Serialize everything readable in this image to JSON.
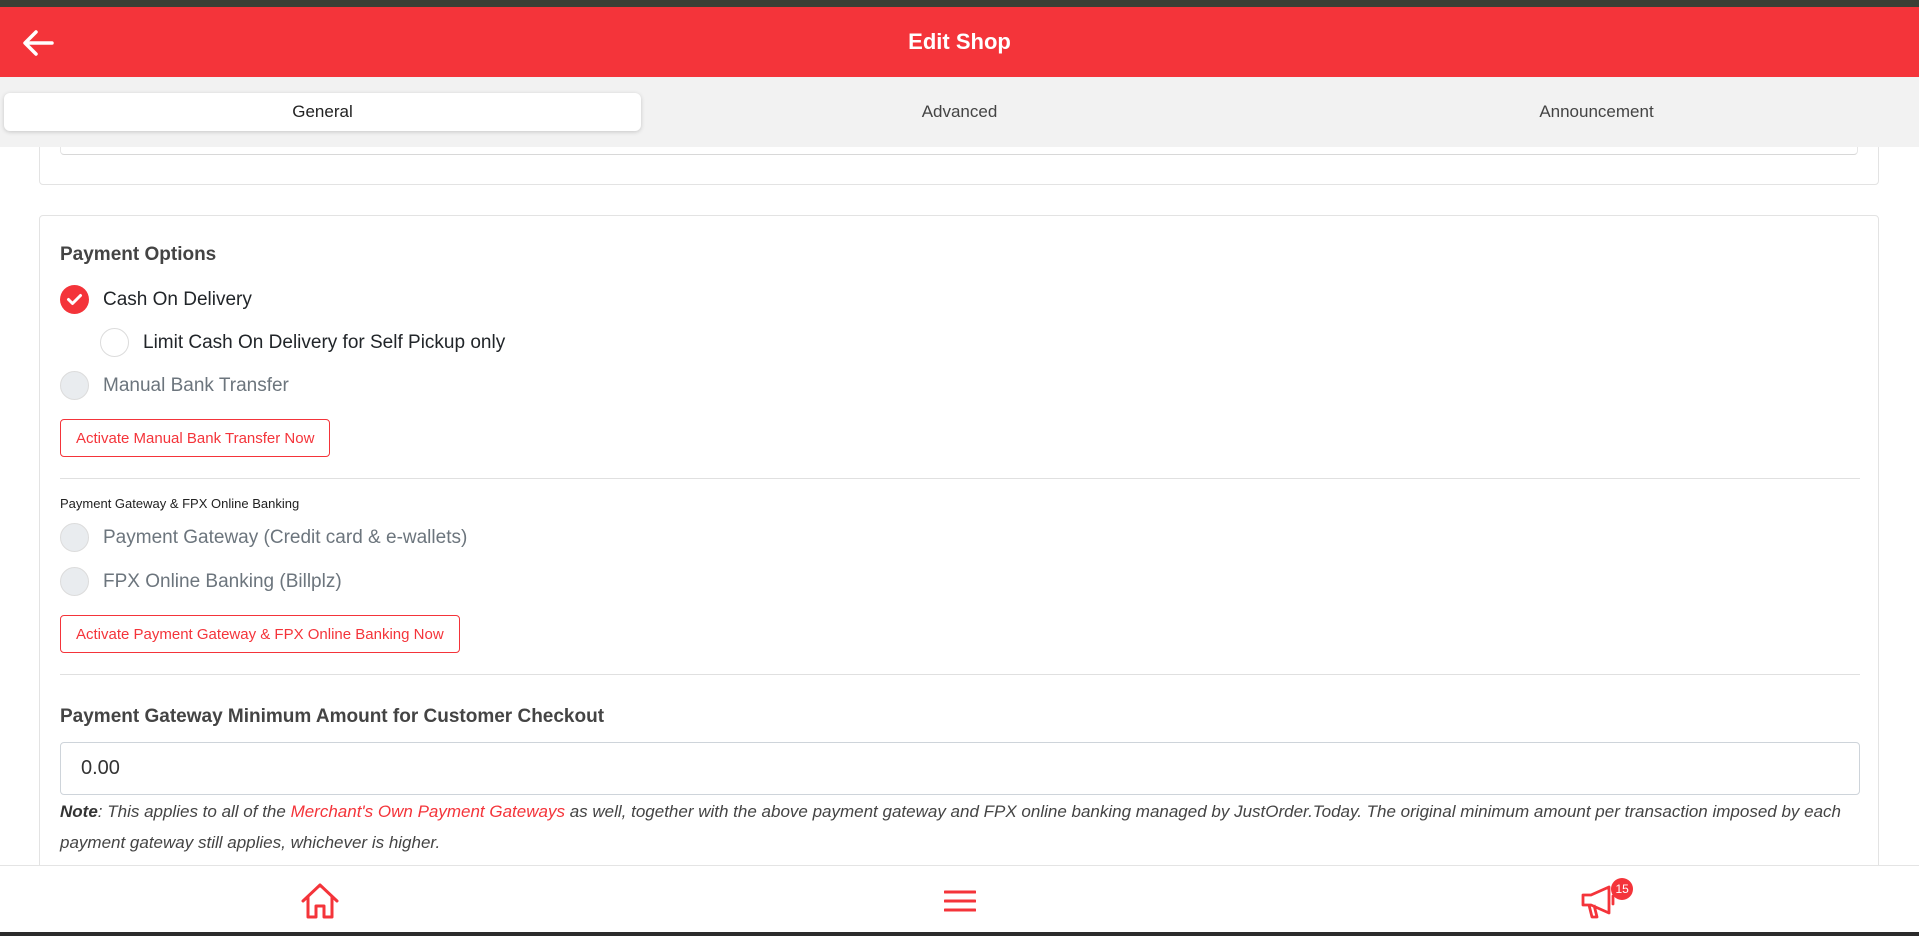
{
  "header": {
    "title": "Edit Shop",
    "back_icon": "arrow-left-icon"
  },
  "tabs": [
    {
      "label": "General",
      "active": true
    },
    {
      "label": "Advanced",
      "active": false
    },
    {
      "label": "Announcement",
      "active": false
    }
  ],
  "payment_options": {
    "title": "Payment Options",
    "cod": {
      "label": "Cash On Delivery",
      "checked": true
    },
    "cod_self_pickup": {
      "label": "Limit Cash On Delivery for Self Pickup only",
      "checked": false
    },
    "manual_bank": {
      "label": "Manual Bank Transfer",
      "checked": false,
      "disabled": true
    },
    "activate_manual_btn": "Activate Manual Bank Transfer Now"
  },
  "gateway_section": {
    "title": "Payment Gateway & FPX Online Banking",
    "gateway": {
      "label": "Payment Gateway (Credit card & e-wallets)",
      "disabled": true
    },
    "fpx": {
      "label": "FPX Online Banking (Billplz)",
      "disabled": true
    },
    "activate_btn": "Activate Payment Gateway & FPX Online Banking Now"
  },
  "minimum_amount": {
    "title": "Payment Gateway Minimum Amount for Customer Checkout",
    "value": "0.00",
    "note_label": "Note",
    "note_prefix": ": This applies to all of the ",
    "note_link": "Merchant's Own Payment Gateways",
    "note_suffix": " as well, together with the above payment gateway and FPX online banking managed by JustOrder.Today. The original minimum amount per transaction imposed by each payment gateway still applies, whichever is higher."
  },
  "bottom_nav": {
    "home_icon": "home-icon",
    "menu_icon": "menu-icon",
    "announcement_icon": "megaphone-icon",
    "badge_count": "15"
  },
  "colors": {
    "accent": "#f4343a",
    "tab_bg": "#f2f2f2"
  }
}
